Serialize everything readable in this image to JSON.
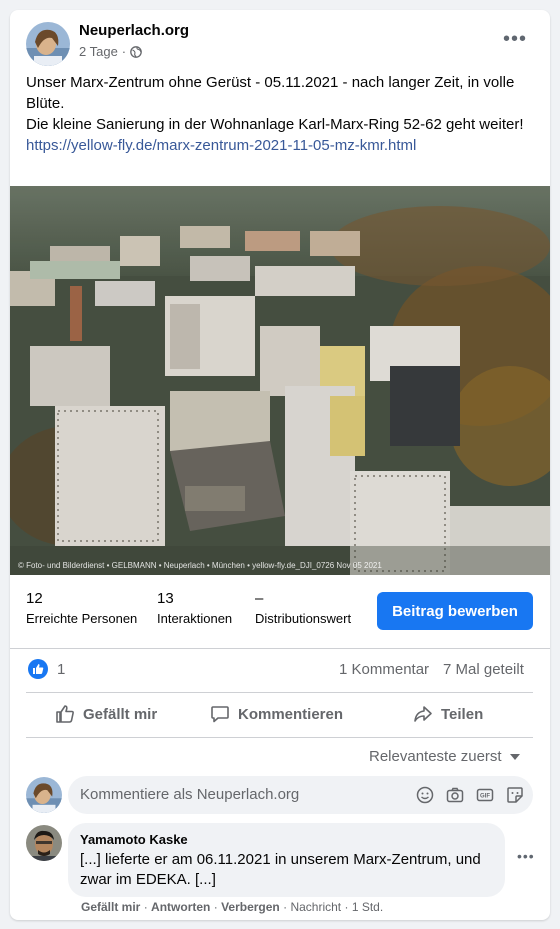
{
  "post": {
    "page_name": "Neuperlach.org",
    "time": "2 Tage",
    "audience_icon": "globe-icon",
    "text_line1": "Unser Marx-Zentrum ohne Gerüst - 05.11.2021 - nach langer Zeit, in volle Blüte.",
    "text_line2": "Die kleine Sanierung in der Wohnanlage Karl-Marx-Ring 52-62 geht weiter!",
    "link": "https://yellow-fly.de/marx-zentrum-2021-11-05-mz-kmr.html",
    "photo_watermark": "© Foto- und Bilderdienst • GELBMANN • Neuperlach • München • yellow-fly.de_DJI_0726 Nov 05 2021"
  },
  "insights": {
    "reach_value": "12",
    "reach_label": "Erreichte Personen",
    "engagement_value": "13",
    "engagement_label": "Interaktionen",
    "distribution_value": "–",
    "distribution_label": "Distributionswert",
    "promote_label": "Beitrag bewerben"
  },
  "reactions": {
    "like_count": "1",
    "comments": "1 Kommentar",
    "shares": "7 Mal geteilt"
  },
  "actions": {
    "like": "Gefällt mir",
    "comment": "Kommentieren",
    "share": "Teilen"
  },
  "comments": {
    "sort_label": "Relevanteste zuerst",
    "input_placeholder": "Kommentiere als Neuperlach.org",
    "items": [
      {
        "author": "Yamamoto Kaske",
        "text": "[...] lieferte er am 06.11.2021 in unserem Marx-Zentrum, und zwar im EDEKA. [...]",
        "like": "Gefällt mir",
        "reply": "Antworten",
        "hide": "Verbergen",
        "type": "Nachricht",
        "time": "1 Std."
      }
    ]
  },
  "colors": {
    "accent": "#1877f2",
    "link": "#385898",
    "secondary_text": "#65676b",
    "background": "#f0f2f5"
  }
}
